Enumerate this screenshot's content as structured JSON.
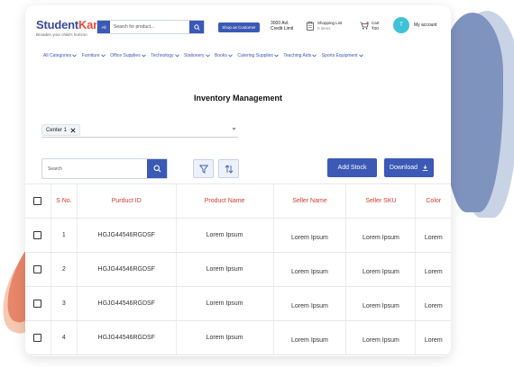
{
  "brand": {
    "name_a": "Student",
    "name_b": "Kare",
    "tagline": "Broaden your child's horizon"
  },
  "header": {
    "search_scope": "All",
    "search_placeholder": "Search for product...",
    "shop_as_customer": "Shop as Customer",
    "credit_amount": "3000 Avl.",
    "credit_label": "Credit Limit",
    "shopping_list_title": "Shopping List",
    "shopping_list_count": "0 items",
    "cart_title": "Cart",
    "cart_amount": "₹00",
    "avatar_initial": "T",
    "account_label": "My account"
  },
  "nav": [
    "All Categories",
    "Furniture",
    "Office Supplies",
    "Technology",
    "Stationery",
    "Books",
    "Catering Supplies",
    "Teaching Aids",
    "Sports Equipment"
  ],
  "page": {
    "title": "Inventory Management",
    "selected_center": "Center 1",
    "search_placeholder": "Search",
    "add_stock_label": "Add Stock",
    "download_label": "Download"
  },
  "table": {
    "headers": [
      "S No.",
      "Purduct ID",
      "Product Name",
      "Seller  Name",
      "Seller SKU",
      "Color"
    ],
    "rows": [
      {
        "sno": "1",
        "product_id": "HGJG44546RGDSF",
        "product_name": "Lorem Ipsum",
        "seller_name": "Lorem Ipsum",
        "seller_sku": "Lorem Ipsum",
        "color": "Lorem"
      },
      {
        "sno": "2",
        "product_id": "HGJG44546RGDSF",
        "product_name": "Lorem Ipsum",
        "seller_name": "Lorem Ipsum",
        "seller_sku": "Lorem Ipsum",
        "color": "Lorem"
      },
      {
        "sno": "3",
        "product_id": "HGJG44546RGDSF",
        "product_name": "Lorem Ipsum",
        "seller_name": "Lorem Ipsum",
        "seller_sku": "Lorem Ipsum",
        "color": "Lorem"
      },
      {
        "sno": "4",
        "product_id": "HGJG44546RGDSF",
        "product_name": "Lorem Ipsum",
        "seller_name": "Lorem Ipsum",
        "seller_sku": "Lorem Ipsum",
        "color": "Lorem"
      }
    ]
  },
  "colors": {
    "primary": "#3b59b5",
    "brand_dark": "#3b4a9c",
    "brand_accent": "#e94b3c",
    "header_text": "#d63b2f",
    "avatar": "#3fc1d8"
  }
}
